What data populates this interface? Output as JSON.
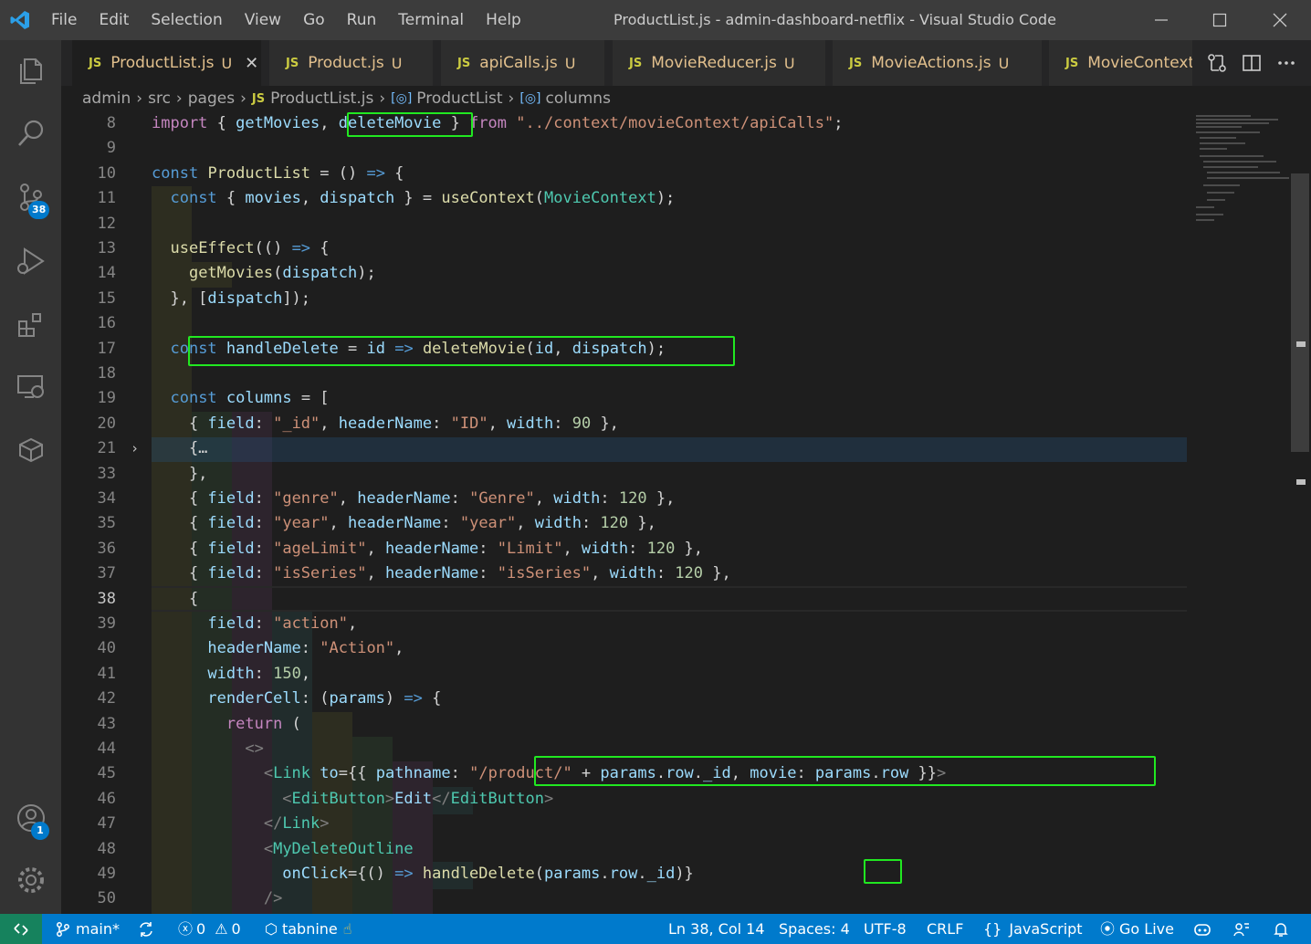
{
  "window": {
    "title": "ProductList.js - admin-dashboard-netflix - Visual Studio Code",
    "menu": [
      "File",
      "Edit",
      "Selection",
      "View",
      "Go",
      "Run",
      "Terminal",
      "Help"
    ]
  },
  "activity_bar": {
    "items": [
      "explorer-icon",
      "search-icon",
      "source-control-icon",
      "run-debug-icon",
      "extensions-icon",
      "remote-explorer-icon",
      "docker-icon"
    ],
    "source_control_badge": "38",
    "accounts_badge": "1"
  },
  "tabs": [
    {
      "lang": "JS",
      "name": "ProductList.js",
      "status": "U",
      "active": true
    },
    {
      "lang": "JS",
      "name": "Product.js",
      "status": "U"
    },
    {
      "lang": "JS",
      "name": "apiCalls.js",
      "status": "U"
    },
    {
      "lang": "JS",
      "name": "MovieReducer.js",
      "status": "U"
    },
    {
      "lang": "JS",
      "name": "MovieActions.js",
      "status": "U"
    },
    {
      "lang": "JS",
      "name": "MovieContext",
      "status": ""
    }
  ],
  "breadcrumb": {
    "items": [
      "admin",
      "src",
      "pages",
      "ProductList.js",
      "ProductList",
      "columns"
    ],
    "file_lang": "JS"
  },
  "editor": {
    "current_line": "38",
    "line_numbers": [
      "8",
      "9",
      "10",
      "11",
      "12",
      "13",
      "14",
      "15",
      "16",
      "17",
      "18",
      "19",
      "20",
      "21",
      "33",
      "34",
      "35",
      "36",
      "37",
      "38",
      "39",
      "40",
      "41",
      "42",
      "43",
      "44",
      "45",
      "46",
      "47",
      "48",
      "49",
      "50"
    ],
    "lines": [
      "import { getMovies, deleteMovie } from \"../context/movieContext/apiCalls\";",
      "",
      "const ProductList = () => {",
      "  const { movies, dispatch } = useContext(MovieContext);",
      "",
      "  useEffect(() => {",
      "    getMovies(dispatch);",
      "  }, [dispatch]);",
      "",
      "  const handleDelete = id => deleteMovie(id, dispatch);",
      "",
      "  const columns = [",
      "    { field: \"_id\", headerName: \"ID\", width: 90 },",
      "    {…",
      "    },",
      "    { field: \"genre\", headerName: \"Genre\", width: 120 },",
      "    { field: \"year\", headerName: \"year\", width: 120 },",
      "    { field: \"ageLimit\", headerName: \"Limit\", width: 120 },",
      "    { field: \"isSeries\", headerName: \"isSeries\", width: 120 },",
      "    {",
      "      field: \"action\",",
      "      headerName: \"Action\",",
      "      width: 150,",
      "      renderCell: (params) => {",
      "        return (",
      "          <>",
      "            <Link to={{ pathname: \"/product/\" + params.row._id, movie: params.row }}>",
      "              <EditButton>Edit</EditButton>",
      "            </Link>",
      "            <MyDeleteOutline",
      "              onClick={() => handleDelete(params.row._id)}",
      "            />"
    ]
  },
  "status_bar": {
    "branch": "main*",
    "errors": "0",
    "warnings": "0",
    "tabnine": "tabnine",
    "position": "Ln 38, Col 14",
    "spaces": "Spaces: 4",
    "encoding": "UTF-8",
    "eol": "CRLF",
    "language": "JavaScript",
    "golive": "Go Live"
  },
  "colors": {
    "statusbar": "#007acc",
    "annotation_box": "#21e821",
    "editor_bg": "#1e1e1e"
  }
}
